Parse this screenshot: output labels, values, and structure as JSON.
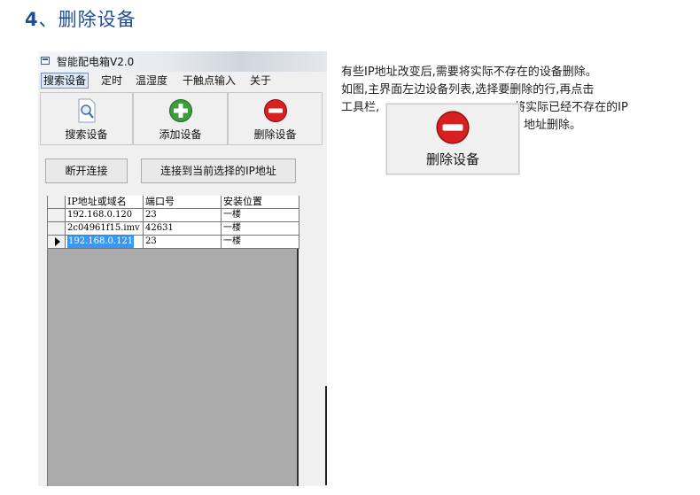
{
  "heading": {
    "number": "4",
    "text": "、删除设备"
  },
  "window": {
    "title": "智能配电箱V2.0"
  },
  "menu": [
    {
      "label": "搜索设备",
      "active": true
    },
    {
      "label": "定时"
    },
    {
      "label": "温湿度"
    },
    {
      "label": "干触点输入"
    },
    {
      "label": "关于"
    }
  ],
  "toolbar": {
    "search": {
      "label": "搜索设备",
      "icon": "magnifier-icon"
    },
    "add": {
      "label": "添加设备",
      "icon": "plus-circle-icon",
      "color": "#3a9e3a"
    },
    "delete": {
      "label": "删除设备",
      "icon": "minus-circle-icon",
      "color": "#d92020"
    }
  },
  "buttons": {
    "disconnect": "断开连接",
    "connect_selected": "连接到当前选择的IP地址"
  },
  "table": {
    "columns": [
      "IP地址或域名",
      "端口号",
      "安装位置"
    ],
    "rows": [
      {
        "ip": "192.168.0.120",
        "port": "23",
        "location": "一楼",
        "selected": false
      },
      {
        "ip": "2c04961f15.imv",
        "port": "42631",
        "location": "一楼",
        "selected": false
      },
      {
        "ip": "192.168.0.121",
        "port": "23",
        "location": "一楼",
        "selected": true
      }
    ]
  },
  "description": {
    "line1": "有些IP地址改变后,需要将实际不存在的设备删除。",
    "line2": "如图,主界面左边设备列表,选择要删除的行,再点击",
    "line3a": "工具栏,",
    "line3b": "将实际已经不存在的IP",
    "line4": "地址删除。",
    "zoom_button_label": "删除设备"
  }
}
